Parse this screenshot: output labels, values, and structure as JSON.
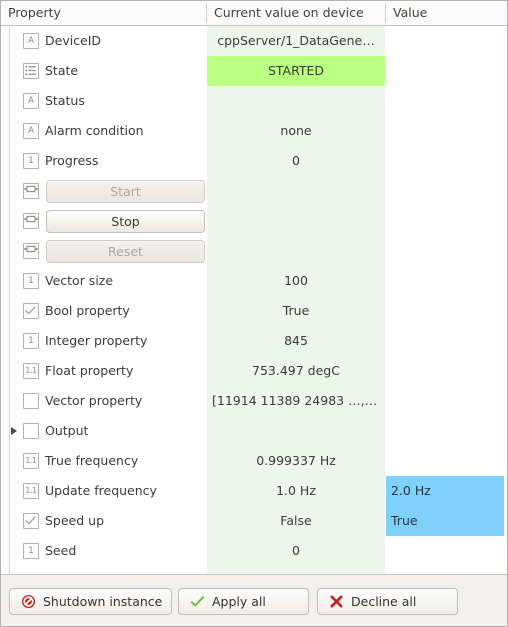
{
  "header": {
    "columns": [
      {
        "key": "property",
        "label": "Property"
      },
      {
        "key": "current",
        "label": "Current value on device"
      },
      {
        "key": "value",
        "label": "Value"
      }
    ]
  },
  "colors": {
    "state_started_bg": "#b9ff82",
    "current_column_bg": "#edf5ed",
    "pending_selection_bg": "#7fd0fb",
    "window_bg": "#f2f1f0"
  },
  "rows": [
    {
      "icon": "string-type-icon",
      "icon_text": "A",
      "label": "DeviceID",
      "current": "cppServer/1_DataGene…",
      "value": ""
    },
    {
      "icon": "enum-type-icon",
      "icon_text": "",
      "label": "State",
      "current": "STARTED",
      "value": "",
      "current_state": "started"
    },
    {
      "icon": "string-type-icon",
      "icon_text": "A",
      "label": "Status",
      "current": "",
      "value": ""
    },
    {
      "icon": "string-type-icon",
      "icon_text": "A",
      "label": "Alarm condition",
      "current": "none",
      "value": ""
    },
    {
      "icon": "integer-type-icon",
      "icon_text": "1",
      "label": "Progress",
      "current": "0",
      "value": ""
    },
    {
      "icon": "command-type-icon",
      "icon_text": "",
      "label": "Start",
      "current": "",
      "value": "",
      "kind": "button",
      "enabled": false
    },
    {
      "icon": "command-type-icon",
      "icon_text": "",
      "label": "Stop",
      "current": "",
      "value": "",
      "kind": "button",
      "enabled": true
    },
    {
      "icon": "command-type-icon",
      "icon_text": "",
      "label": "Reset",
      "current": "",
      "value": "",
      "kind": "button",
      "enabled": false
    },
    {
      "icon": "integer-type-icon",
      "icon_text": "1",
      "label": "Vector size",
      "current": "100",
      "value": ""
    },
    {
      "icon": "bool-type-icon",
      "icon_text": "",
      "label": "Bool property",
      "current": "True",
      "value": ""
    },
    {
      "icon": "integer-type-icon",
      "icon_text": "1",
      "label": "Integer property",
      "current": "845",
      "value": ""
    },
    {
      "icon": "float-type-icon",
      "icon_text": "1.1",
      "label": "Float property",
      "current": "753.497 degC",
      "value": ""
    },
    {
      "icon": "vector-type-icon",
      "icon_text": "",
      "label": "Vector property",
      "current": "[11914 11389 24983 …,…",
      "value": "",
      "current_align": "left"
    },
    {
      "icon": "vector-type-icon",
      "icon_text": "",
      "label": "Output",
      "current": "",
      "value": "",
      "expandable": true
    },
    {
      "icon": "float-type-icon",
      "icon_text": "1.1",
      "label": "True frequency",
      "current": "0.999337 Hz",
      "value": ""
    },
    {
      "icon": "float-type-icon",
      "icon_text": "1.1",
      "label": "Update frequency",
      "current": "1.0 Hz",
      "value": "2.0 Hz",
      "value_selected": true
    },
    {
      "icon": "bool-type-icon",
      "icon_text": "",
      "label": "Speed up",
      "current": "False",
      "value": "True",
      "value_selected": true
    },
    {
      "icon": "integer-type-icon",
      "icon_text": "1",
      "label": "Seed",
      "current": "0",
      "value": ""
    }
  ],
  "footer": {
    "buttons": [
      {
        "id": "shutdown",
        "label": "Shutdown instance",
        "icon": "forbidden-icon"
      },
      {
        "id": "apply",
        "label": "Apply all",
        "icon": "check-icon"
      },
      {
        "id": "decline",
        "label": "Decline all",
        "icon": "cross-icon"
      }
    ]
  }
}
